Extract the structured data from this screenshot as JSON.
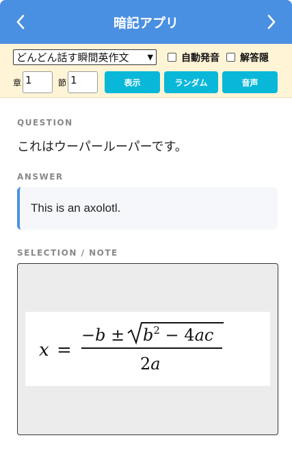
{
  "header": {
    "title": "暗記アプリ",
    "prev_icon": "chevron-left-icon",
    "next_icon": "chevron-right-icon",
    "color": "#4a90e2"
  },
  "controls": {
    "book_select_value": "どんどん話す瞬間英作文",
    "auto_audio_label": "自動発音",
    "hide_answer_label": "解答隠",
    "chapter_label": "章",
    "chapter_value": "1",
    "section_label": "節",
    "section_value": "1",
    "show_button": "表示",
    "random_button": "ランダム",
    "audio_button": "音声",
    "button_color": "#09b8d9",
    "background": "#fff4d6"
  },
  "content": {
    "question_label": "QUESTION",
    "question_text": "これはウーパールーパーです。",
    "answer_label": "ANSWER",
    "answer_text": "This is an axolotl.",
    "note_label": "SELECTION / NOTE",
    "note_image": {
      "description": "quadratic-formula-image",
      "lhs": "x",
      "equals": "=",
      "numerator": "−b ± √(b² − 4ac)",
      "denominator": "2a"
    }
  }
}
